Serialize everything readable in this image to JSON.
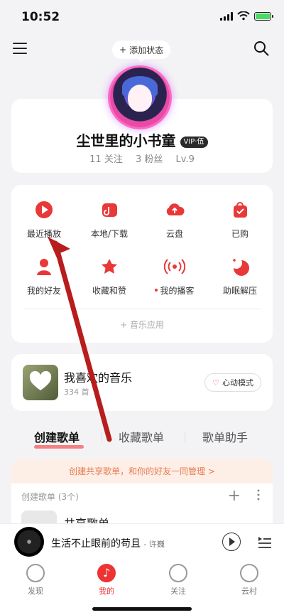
{
  "status_bar": {
    "time": "10:52"
  },
  "top": {
    "add_status": "添加状态"
  },
  "profile": {
    "name": "尘世里的小书童",
    "vip": "VIP·伍",
    "follows": "11 关注",
    "fans": "3 粉丝",
    "level": "Lv.9"
  },
  "shortcuts": [
    {
      "label": "最近播放",
      "icon": "play-icon"
    },
    {
      "label": "本地/下载",
      "icon": "download-folder-icon"
    },
    {
      "label": "云盘",
      "icon": "cloud-upload-icon"
    },
    {
      "label": "已购",
      "icon": "shopping-bag-icon"
    },
    {
      "label": "我的好友",
      "icon": "friends-icon"
    },
    {
      "label": "收藏和赞",
      "icon": "star-icon"
    },
    {
      "label": "我的播客",
      "icon": "podcast-icon"
    },
    {
      "label": "助眠解压",
      "icon": "moon-icon"
    }
  ],
  "music_app": "+ 音乐应用",
  "favorite": {
    "title": "我喜欢的音乐",
    "count": "334 首",
    "mode": "心动模式"
  },
  "tabs": [
    "创建歌单",
    "收藏歌单",
    "歌单助手"
  ],
  "share_banner": "创建共享歌单，和你的好友一同管理 >",
  "created": {
    "label": "创建歌单 (3个)",
    "playlist": "共享歌单"
  },
  "player": {
    "song": "生活不止眼前的苟且",
    "artist": "- 许巍"
  },
  "nav": [
    "发现",
    "我的",
    "关注",
    "云村"
  ],
  "colors": {
    "accent": "#e83838",
    "annotation_arrow": "#b81d1d"
  }
}
